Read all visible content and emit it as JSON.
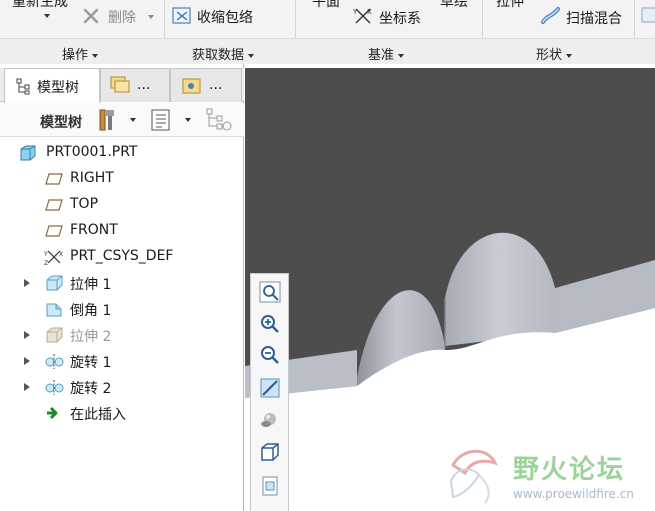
{
  "ribbon": {
    "top_row": {
      "regenerate": "重新生成",
      "plane": "平面",
      "sketch": "草绘",
      "extrude": "拉伸"
    },
    "buttons": {
      "delete": "删除",
      "shrinkwrap": "收缩包络",
      "csys": "坐标系",
      "swept_blend": "扫描混合"
    },
    "groups": {
      "operations": "操作",
      "get_data": "获取数据",
      "datum": "基准",
      "shapes": "形状"
    }
  },
  "panel": {
    "tabs": {
      "model_tree": "模型树",
      "tab2": "...",
      "tab3": "..."
    },
    "toolbar_title": "模型树",
    "tree": [
      {
        "label": "PRT0001.PRT",
        "icon": "part-icon",
        "expandable": false,
        "dim": false
      },
      {
        "label": "RIGHT",
        "icon": "datum-plane-icon",
        "expandable": false,
        "dim": false
      },
      {
        "label": "TOP",
        "icon": "datum-plane-icon",
        "expandable": false,
        "dim": false
      },
      {
        "label": "FRONT",
        "icon": "datum-plane-icon",
        "expandable": false,
        "dim": false
      },
      {
        "label": "PRT_CSYS_DEF",
        "icon": "csys-icon",
        "expandable": false,
        "dim": false
      },
      {
        "label": "拉伸 1",
        "icon": "extrude-icon",
        "expandable": true,
        "dim": false
      },
      {
        "label": "倒角 1",
        "icon": "chamfer-icon",
        "expandable": false,
        "dim": false
      },
      {
        "label": "拉伸 2",
        "icon": "extrude-icon",
        "expandable": true,
        "dim": true
      },
      {
        "label": "旋转 1",
        "icon": "revolve-icon",
        "expandable": true,
        "dim": false
      },
      {
        "label": "旋转 2",
        "icon": "revolve-icon",
        "expandable": true,
        "dim": false
      },
      {
        "label": "在此插入",
        "icon": "insert-here-icon",
        "expandable": false,
        "dim": false
      }
    ]
  },
  "watermark": {
    "title": "野火论坛",
    "url": "www.proewildfire.cn"
  },
  "colors": {
    "viewport_bg": "#4d4d4d",
    "model_surface": "#b5b9c1",
    "model_white": "#ffffff",
    "ribbon_bg": "#f3f3f3"
  }
}
